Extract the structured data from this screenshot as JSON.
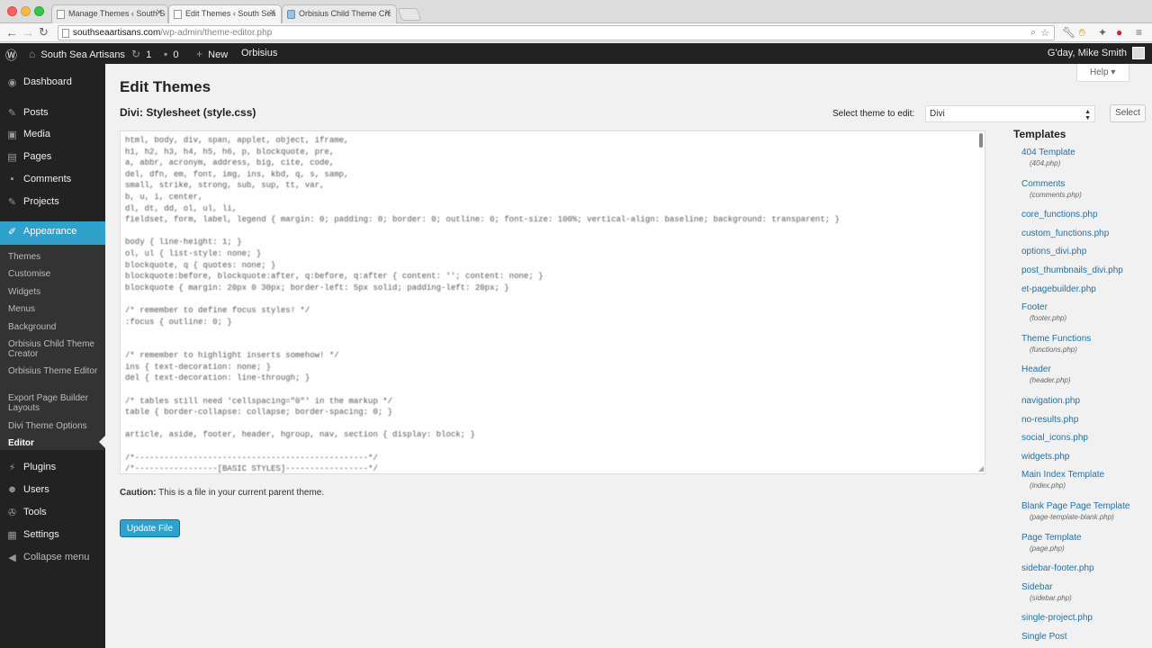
{
  "browser": {
    "tabs": [
      {
        "title": "Manage Themes ‹ South Sea",
        "active": false
      },
      {
        "title": "Edit Themes ‹ South Sea A",
        "active": true
      },
      {
        "title": "Orbisius Child Theme Crea",
        "active": false
      }
    ],
    "url_host": "southseaartisans.com",
    "url_path": "/wp-admin/theme-editor.php"
  },
  "adminbar": {
    "site_name": "South Sea Artisans",
    "updates_count": "1",
    "comments_count": "0",
    "new_label": "New",
    "plugin_link": "Orbisius",
    "greeting": "G'day, Mike Smith"
  },
  "sidebar": {
    "items": [
      {
        "label": "Dashboard",
        "icon": "dashboard-icon"
      },
      {
        "label": "Posts",
        "icon": "pin-icon"
      },
      {
        "label": "Media",
        "icon": "media-icon"
      },
      {
        "label": "Pages",
        "icon": "pages-icon"
      },
      {
        "label": "Comments",
        "icon": "comment-icon"
      },
      {
        "label": "Projects",
        "icon": "pin-icon"
      },
      {
        "label": "Appearance",
        "icon": "brush-icon"
      },
      {
        "label": "Plugins",
        "icon": "plug-icon"
      },
      {
        "label": "Users",
        "icon": "users-icon"
      },
      {
        "label": "Tools",
        "icon": "wrench-icon"
      },
      {
        "label": "Settings",
        "icon": "settings-icon"
      },
      {
        "label": "Collapse menu",
        "icon": "collapse-icon"
      }
    ],
    "appearance_sub": [
      "Themes",
      "Customise",
      "Widgets",
      "Menus",
      "Background",
      "Orbisius Child Theme Creator",
      "Orbisius Theme Editor",
      "Export Page Builder Layouts",
      "Divi Theme Options",
      "Editor"
    ]
  },
  "main": {
    "help_label": "Help",
    "page_title": "Edit Themes",
    "file_title": "Divi: Stylesheet (style.css)",
    "select_label": "Select theme to edit:",
    "selected_theme": "Divi",
    "select_button": "Select",
    "code_lines": [
      "html, body, div, span, applet, object, iframe,",
      "h1, h2, h3, h4, h5, h6, p, blockquote, pre,",
      "a, abbr, acronym, address, big, cite, code,",
      "del, dfn, em, font, img, ins, kbd, q, s, samp,",
      "small, strike, strong, sub, sup, tt, var,",
      "b, u, i, center,",
      "dl, dt, dd, ol, ul, li,",
      "fieldset, form, label, legend { margin: 0; padding: 0; border: 0; outline: 0; font-size: 100%; vertical-align: baseline; background: transparent; }",
      "",
      "body { line-height: 1; }",
      "ol, ul { list-style: none; }",
      "blockquote, q { quotes: none; }",
      "blockquote:before, blockquote:after, q:before, q:after { content: ''; content: none; }",
      "blockquote { margin: 20px 0 30px; border-left: 5px solid; padding-left: 20px; }",
      "",
      "/* remember to define focus styles! */",
      ":focus { outline: 0; }",
      "",
      "",
      "/* remember to highlight inserts somehow! */",
      "ins { text-decoration: none; }",
      "del { text-decoration: line-through; }",
      "",
      "/* tables still need 'cellspacing=\"0\"' in the markup */",
      "table { border-collapse: collapse; border-spacing: 0; }",
      "",
      "article, aside, footer, header, hgroup, nav, section { display: block; }",
      "",
      "/*------------------------------------------------*/",
      "/*-----------------[BASIC STYLES]-----------------*/",
      "/*------------------------------------------------*/"
    ],
    "caution_label": "Caution:",
    "caution_text": " This is a file in your current parent theme.",
    "update_button": "Update File"
  },
  "templates": {
    "heading": "Templates",
    "items": [
      {
        "name": "404 Template",
        "file": "(404.php)"
      },
      {
        "name": "Comments",
        "file": "(comments.php)"
      },
      {
        "name": "core_functions.php",
        "file": ""
      },
      {
        "name": "custom_functions.php",
        "file": ""
      },
      {
        "name": "options_divi.php",
        "file": ""
      },
      {
        "name": "post_thumbnails_divi.php",
        "file": ""
      },
      {
        "name": "et-pagebuilder.php",
        "file": ""
      },
      {
        "name": "Footer",
        "file": "(footer.php)"
      },
      {
        "name": "Theme Functions",
        "file": "(functions.php)"
      },
      {
        "name": "Header",
        "file": "(header.php)"
      },
      {
        "name": "navigation.php",
        "file": ""
      },
      {
        "name": "no-results.php",
        "file": ""
      },
      {
        "name": "social_icons.php",
        "file": ""
      },
      {
        "name": "widgets.php",
        "file": ""
      },
      {
        "name": "Main Index Template",
        "file": "(index.php)"
      },
      {
        "name": "Blank Page Page Template",
        "file": "(page-template-blank.php)"
      },
      {
        "name": "Page Template",
        "file": "(page.php)"
      },
      {
        "name": "sidebar-footer.php",
        "file": ""
      },
      {
        "name": "Sidebar",
        "file": "(sidebar.php)"
      },
      {
        "name": "single-project.php",
        "file": ""
      },
      {
        "name": "Single Post",
        "file": ""
      }
    ]
  },
  "colors": {
    "admin_dark": "#222222",
    "accent": "#2ea2cc",
    "link": "#2371a8"
  }
}
